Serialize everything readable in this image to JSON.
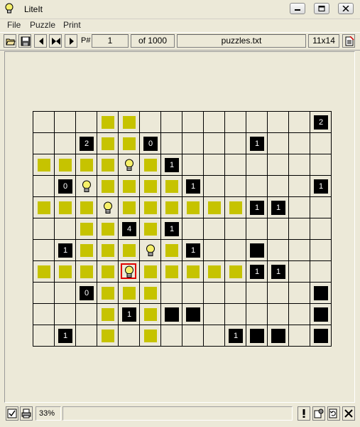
{
  "window": {
    "title": "LiteIt"
  },
  "menu": [
    "File",
    "Puzzle",
    "Print"
  ],
  "toolbar": {
    "puzzle_label": "P#",
    "puzzle_number": "1",
    "of_label": "of 1000",
    "filename": "puzzles.txt",
    "size": "11x14"
  },
  "status": {
    "progress": "33%"
  },
  "colors": {
    "lit": "#c6c300",
    "wall": "#000000",
    "selection": "#e00000",
    "bulb": "#f6f06a"
  },
  "board": {
    "rows": 11,
    "cols": 14,
    "cells": [
      [
        "",
        "",
        "",
        "L",
        "L",
        "",
        "",
        "",
        "",
        "",
        "",
        "",
        "",
        "2"
      ],
      [
        "",
        "",
        "2",
        "L",
        "L",
        "0",
        "",
        "",
        "",
        "",
        "1",
        "",
        "",
        ""
      ],
      [
        "L",
        "L",
        "L",
        "L",
        "B",
        "L",
        "1",
        "",
        "",
        "",
        "",
        "",
        "",
        ""
      ],
      [
        "",
        "0",
        "B",
        "L",
        "L",
        "L",
        "L",
        "1",
        "",
        "",
        "",
        "",
        "",
        "1"
      ],
      [
        "L",
        "L",
        "L",
        "B",
        "L",
        "L",
        "L",
        "L",
        "L",
        "L",
        "1",
        "1",
        "",
        ""
      ],
      [
        "",
        "",
        "L",
        "L",
        "4",
        "L",
        "1",
        "",
        "",
        "",
        "",
        "",
        "",
        ""
      ],
      [
        "",
        "1",
        "L",
        "L",
        "L",
        "B",
        "L",
        "1",
        "",
        "",
        "X",
        "",
        "",
        ""
      ],
      [
        "L",
        "L",
        "L",
        "L",
        "S",
        "L",
        "L",
        "L",
        "L",
        "L",
        "1",
        "1",
        "",
        ""
      ],
      [
        "",
        "",
        "0",
        "L",
        "L",
        "L",
        "",
        "",
        "",
        "",
        "",
        "",
        "",
        "X"
      ],
      [
        "",
        "",
        "",
        "L",
        "1",
        "L",
        "X",
        "X",
        "",
        "",
        "",
        "",
        "",
        "X"
      ],
      [
        "",
        "1",
        "",
        "L",
        "",
        "L",
        "",
        "",
        "",
        "1",
        "X",
        "X",
        "",
        "X"
      ]
    ]
  }
}
